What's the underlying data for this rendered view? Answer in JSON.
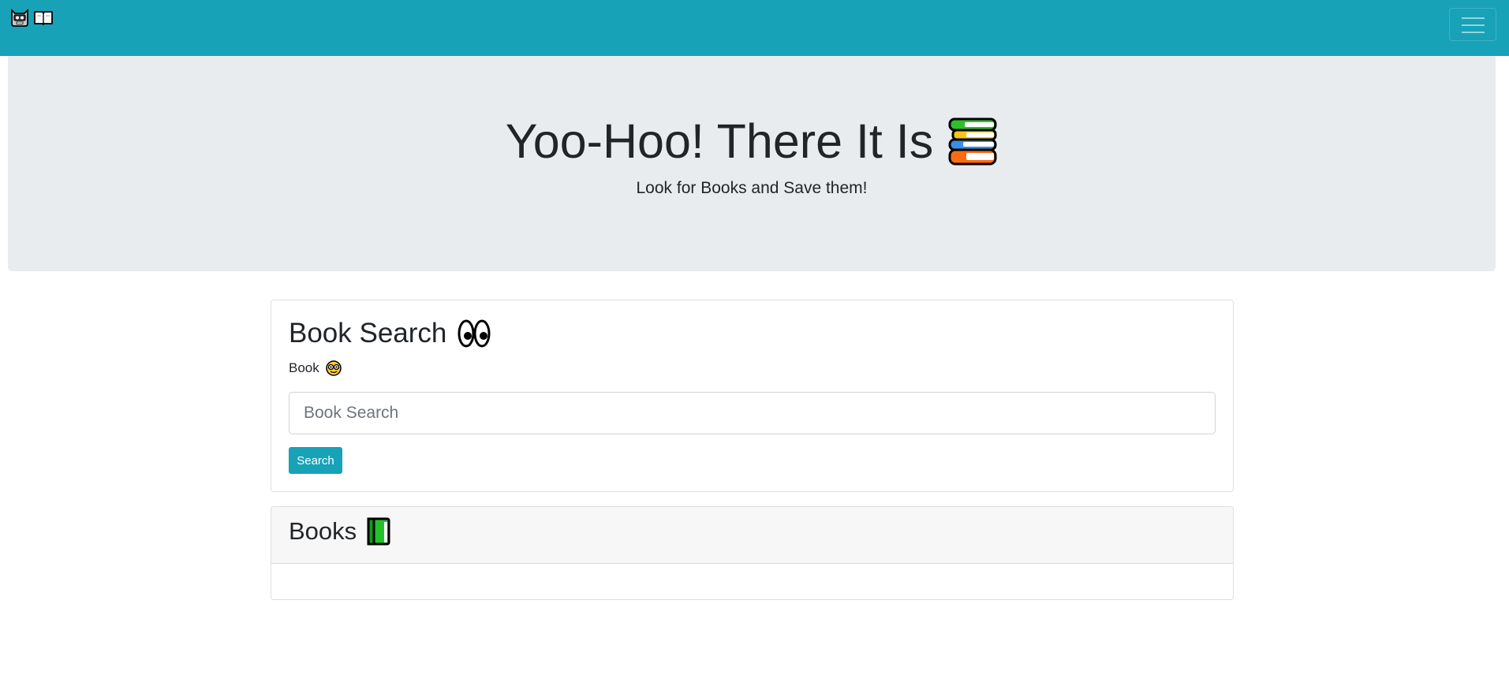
{
  "navbar": {
    "brand_icons": [
      "robot-face-icon",
      "open-book-icon"
    ],
    "toggler_icon": "hamburger-menu-icon",
    "background": "#17a2b8"
  },
  "hero": {
    "title": "Yoo-Hoo! There It Is",
    "title_icon": "stack-of-books-icon",
    "subtitle": "Look for Books and Save them!",
    "background": "#e9ecef"
  },
  "search_card": {
    "title": "Book Search",
    "title_icon": "eyes-icon",
    "field_label": "Book",
    "field_label_icon": "nerd-face-icon",
    "input_placeholder": "Book Search",
    "input_value": "",
    "button_label": "Search"
  },
  "books_card": {
    "title": "Books",
    "title_icon": "green-book-icon",
    "items": []
  }
}
